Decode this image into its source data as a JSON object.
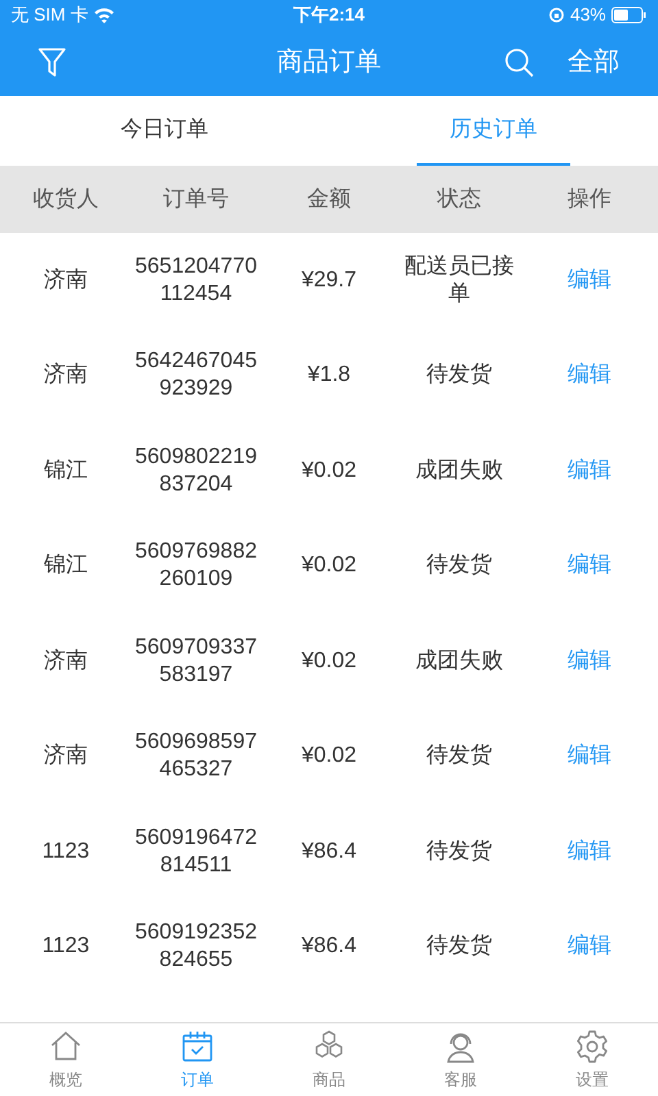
{
  "status_bar": {
    "carrier": "无 SIM 卡",
    "time": "下午2:14",
    "battery": "43%"
  },
  "header": {
    "title": "商品订单",
    "filter_label": "全部"
  },
  "tabs": [
    {
      "label": "今日订单",
      "selected": false
    },
    {
      "label": "历史订单",
      "selected": true
    }
  ],
  "table": {
    "columns": [
      "收货人",
      "订单号",
      "金额",
      "状态",
      "操作"
    ],
    "rows": [
      {
        "receiver": "济南",
        "order_no": "5651204770112454",
        "amount": "¥29.7",
        "status": "配送员已接单",
        "action": "编辑"
      },
      {
        "receiver": "济南",
        "order_no": "5642467045923929",
        "amount": "¥1.8",
        "status": "待发货",
        "action": "编辑"
      },
      {
        "receiver": "锦江",
        "order_no": "5609802219837204",
        "amount": "¥0.02",
        "status": "成团失败",
        "action": "编辑"
      },
      {
        "receiver": "锦江",
        "order_no": "5609769882260109",
        "amount": "¥0.02",
        "status": "待发货",
        "action": "编辑"
      },
      {
        "receiver": "济南",
        "order_no": "5609709337583197",
        "amount": "¥0.02",
        "status": "成团失败",
        "action": "编辑"
      },
      {
        "receiver": "济南",
        "order_no": "5609698597465327",
        "amount": "¥0.02",
        "status": "待发货",
        "action": "编辑"
      },
      {
        "receiver": "1123",
        "order_no": "5609196472814511",
        "amount": "¥86.4",
        "status": "待发货",
        "action": "编辑"
      },
      {
        "receiver": "1123",
        "order_no": "5609192352824655",
        "amount": "¥86.4",
        "status": "待发货",
        "action": "编辑"
      }
    ]
  },
  "bottom_nav": [
    {
      "label": "概览",
      "kind": "home",
      "selected": false
    },
    {
      "label": "订单",
      "kind": "calendar",
      "selected": true
    },
    {
      "label": "商品",
      "kind": "hexagons",
      "selected": false
    },
    {
      "label": "客服",
      "kind": "headset",
      "selected": false
    },
    {
      "label": "设置",
      "kind": "gear",
      "selected": false
    }
  ]
}
